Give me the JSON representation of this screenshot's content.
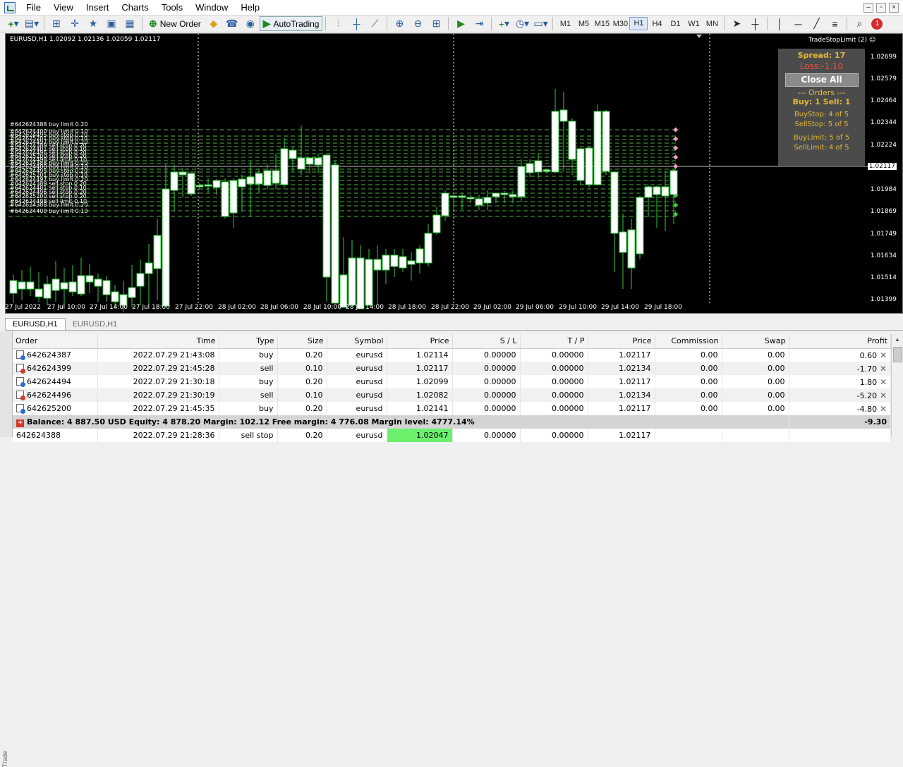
{
  "menu": [
    "File",
    "View",
    "Insert",
    "Charts",
    "Tools",
    "Window",
    "Help"
  ],
  "toolbar": {
    "new_order": "New Order",
    "autotrading": "AutoTrading",
    "timeframes": [
      "M1",
      "M5",
      "M15",
      "M30",
      "H1",
      "H4",
      "D1",
      "W1",
      "MN"
    ],
    "active_timeframe": "H1",
    "notification_count": "1"
  },
  "chart": {
    "header": "EURUSD,H1  1.02092 1.02136 1.02059 1.02117",
    "ea_name": "TradeStopLimit (2) ☺",
    "current_price": "1.02117",
    "price_labels": [
      "1.02699",
      "1.02579",
      "1.02464",
      "1.02344",
      "1.02224",
      "1.02117",
      "1.01984",
      "1.01869",
      "1.01749",
      "1.01634",
      "1.01514",
      "1.01399"
    ],
    "time_labels": [
      "27 Jul 2022",
      "27 Jul 10:00",
      "27 Jul 14:00",
      "27 Jul 18:00",
      "27 Jul 22:00",
      "28 Jul 02:00",
      "28 Jul 06:00",
      "28 Jul 10:00",
      "28 Jul 14:00",
      "28 Jul 18:00",
      "28 Jul 22:00",
      "29 Jul 02:00",
      "29 Jul 06:00",
      "29 Jul 10:00",
      "29 Jul 14:00",
      "29 Jul 18:00"
    ],
    "order_labels": [
      "#642624388 buy limit 0.20",
      "#642624400 buy limit 0.10",
      "#642624495 buy stop 0.20",
      "#642625201 buy stop 0.10",
      "#642624497 buy limit 0.20",
      "#642624389 sell stop 0.20",
      "#642624401 sell stop 0.10",
      "#642624496 sell stop 0.20",
      "#642625200 sell stop 0.20",
      "#642624498 sell limit 0.10"
    ]
  },
  "panel": {
    "spread": "Spread: 17",
    "loss": "Loss:-1.10",
    "close_all": "Close All",
    "orders_header": "--- Orders ---",
    "buy_sell": "Buy: 1  Sell: 1",
    "buystop": "BuyStop: 4 of 5",
    "sellstop": "SellStop: 5 of 5",
    "buylimit": "BuyLimit: 5 of 5",
    "selllimit": "SellLimit: 4 of 5"
  },
  "tabs": [
    "EURUSD,H1",
    "EURUSD,H1"
  ],
  "terminal": {
    "columns": [
      "Order",
      "Time",
      "Type",
      "Size",
      "Symbol",
      "Price",
      "S / L",
      "T / P",
      "Price",
      "Commission",
      "Swap",
      "Profit"
    ],
    "rows": [
      {
        "order": "642624387",
        "time": "2022.07.29 21:43:08",
        "type": "buy",
        "size": "0.20",
        "symbol": "eurusd",
        "price": "1.02114",
        "sl": "0.00000",
        "tp": "0.00000",
        "cur": "1.02117",
        "commission": "0.00",
        "swap": "0.00",
        "profit": "0.60",
        "side": "buy"
      },
      {
        "order": "642624399",
        "time": "2022.07.29 21:45:28",
        "type": "sell",
        "size": "0.10",
        "symbol": "eurusd",
        "price": "1.02117",
        "sl": "0.00000",
        "tp": "0.00000",
        "cur": "1.02134",
        "commission": "0.00",
        "swap": "0.00",
        "profit": "-1.70",
        "side": "sell"
      },
      {
        "order": "642624494",
        "time": "2022.07.29 21:30:18",
        "type": "buy",
        "size": "0.20",
        "symbol": "eurusd",
        "price": "1.02099",
        "sl": "0.00000",
        "tp": "0.00000",
        "cur": "1.02117",
        "commission": "0.00",
        "swap": "0.00",
        "profit": "1.80",
        "side": "buy"
      },
      {
        "order": "642624496",
        "time": "2022.07.29 21:30:19",
        "type": "sell",
        "size": "0.10",
        "symbol": "eurusd",
        "price": "1.02082",
        "sl": "0.00000",
        "tp": "0.00000",
        "cur": "1.02134",
        "commission": "0.00",
        "swap": "0.00",
        "profit": "-5.20",
        "side": "sell"
      },
      {
        "order": "642625200",
        "time": "2022.07.29 21:45:35",
        "type": "buy",
        "size": "0.20",
        "symbol": "eurusd",
        "price": "1.02141",
        "sl": "0.00000",
        "tp": "0.00000",
        "cur": "1.02117",
        "commission": "0.00",
        "swap": "0.00",
        "profit": "-4.80",
        "side": "buy"
      }
    ],
    "balance_line": "Balance: 4 887.50 USD  Equity: 4 878.20  Margin: 102.12  Free margin: 4 776.08  Margin level: 4777.14%",
    "balance_profit": "-9.30",
    "pending": {
      "order": "642624388",
      "time": "2022.07.29 21:28:36",
      "type": "sell stop",
      "size": "0.20",
      "symbol": "eurusd",
      "price": "1.02047",
      "sl": "0.00000",
      "tp": "0.00000",
      "cur": "1.02117"
    },
    "side_label": "Trade"
  }
}
